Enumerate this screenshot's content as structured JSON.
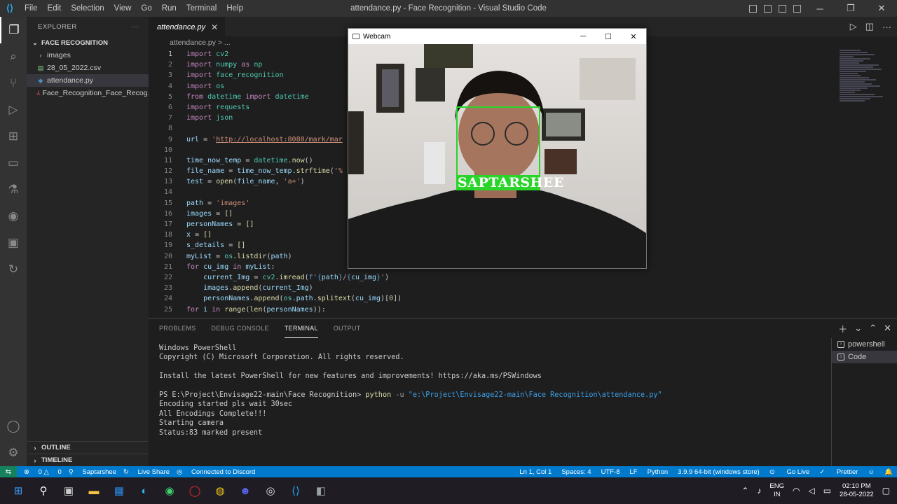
{
  "titlebar": {
    "menu": [
      "File",
      "Edit",
      "Selection",
      "View",
      "Go",
      "Run",
      "Terminal",
      "Help"
    ],
    "title": "attendance.py - Face Recognition - Visual Studio Code"
  },
  "sidebar": {
    "header": "EXPLORER",
    "folder": "FACE RECOGNITION",
    "items": [
      {
        "label": "images",
        "icon": "folder-chevron-icon"
      },
      {
        "label": "28_05_2022.csv",
        "icon": "csv-file-icon"
      },
      {
        "label": "attendance.py",
        "icon": "python-file-icon"
      },
      {
        "label": "Face_Recognition_Face_Recog...",
        "icon": "pdf-file-icon"
      }
    ],
    "outline": "OUTLINE",
    "timeline": "TIMELINE"
  },
  "editor": {
    "tab": "attendance.py",
    "breadcrumb": "attendance.py > ...",
    "lines": [
      {
        "n": "1",
        "t": "import cv2"
      },
      {
        "n": "2",
        "t": "import numpy as np"
      },
      {
        "n": "3",
        "t": "import face_recognition"
      },
      {
        "n": "4",
        "t": "import os"
      },
      {
        "n": "5",
        "t": "from datetime import datetime"
      },
      {
        "n": "6",
        "t": "import requests"
      },
      {
        "n": "7",
        "t": "import json"
      },
      {
        "n": "8",
        "t": ""
      },
      {
        "n": "9",
        "t": "url = 'http://localhost:8080/mark/mar"
      },
      {
        "n": "10",
        "t": ""
      },
      {
        "n": "11",
        "t": "time_now_temp = datetime.now()"
      },
      {
        "n": "12",
        "t": "file_name = time_now_temp.strftime('%"
      },
      {
        "n": "13",
        "t": "test = open(file_name, 'a+')"
      },
      {
        "n": "14",
        "t": ""
      },
      {
        "n": "15",
        "t": "path = 'images'"
      },
      {
        "n": "16",
        "t": "images = []"
      },
      {
        "n": "17",
        "t": "personNames = []"
      },
      {
        "n": "18",
        "t": "x = []"
      },
      {
        "n": "19",
        "t": "s_details = []"
      },
      {
        "n": "20",
        "t": "myList = os.listdir(path)"
      },
      {
        "n": "21",
        "t": "for cu_img in myList:"
      },
      {
        "n": "22",
        "t": "    current_Img = cv2.imread(f'{path}/{cu_img}')"
      },
      {
        "n": "23",
        "t": "    images.append(current_Img)"
      },
      {
        "n": "24",
        "t": "    personNames.append(os.path.splitext(cu_img)[0])"
      },
      {
        "n": "25",
        "t": "for i in range(len(personNames)):"
      }
    ]
  },
  "panel": {
    "tabs": [
      "PROBLEMS",
      "DEBUG CONSOLE",
      "TERMINAL",
      "OUTPUT"
    ],
    "active_tab": "TERMINAL",
    "terminal": {
      "l1": "Windows PowerShell",
      "l2": "Copyright (C) Microsoft Corporation. All rights reserved.",
      "l3": "Install the latest PowerShell for new features and improvements! https://aka.ms/PSWindows",
      "prompt": "PS E:\\Project\\Envisage22-main\\Face Recognition> ",
      "cmd": "python",
      "arg": " -u ",
      "path": "\"e:\\Project\\Envisage22-main\\Face Recognition\\attendance.py\"",
      "o1": "Encoding started pls wait 30sec",
      "o2": "All Encodings Complete!!!",
      "o3": "Starting camera",
      "o4": "Status:83 marked present"
    },
    "terminals": [
      "powershell",
      "Code"
    ]
  },
  "webcam": {
    "title": "Webcam",
    "detected_name": "SAPTARSHEE"
  },
  "statusbar": {
    "errors": "0",
    "warnings": "0",
    "user": "Saptarshee",
    "live_share": "Live Share",
    "discord": "Connected to Discord",
    "position": "Ln 1, Col 1",
    "spaces": "Spaces: 4",
    "encoding": "UTF-8",
    "eol": "LF",
    "language": "Python",
    "interpreter": "3.9.9 64-bit (windows store)",
    "go_live": "Go Live",
    "prettier": "Prettier"
  },
  "taskbar": {
    "lang1": "ENG",
    "lang2": "IN",
    "time": "02:10 PM",
    "date": "28-05-2022"
  },
  "colors": {
    "accent": "#007acc",
    "box": "#2bd42b"
  }
}
